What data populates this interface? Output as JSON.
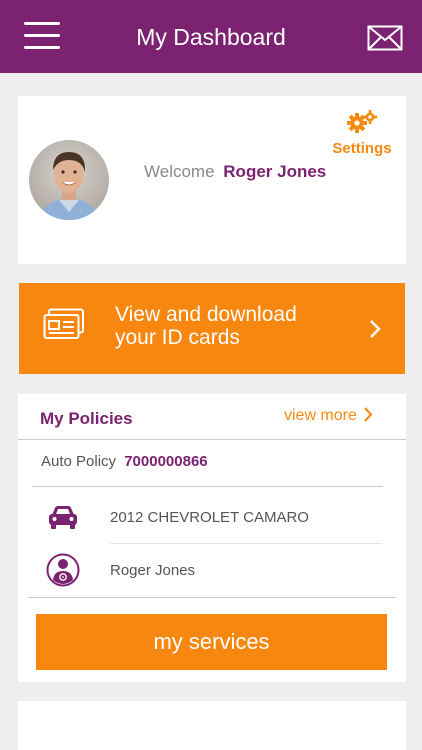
{
  "header": {
    "title": "My Dashboard",
    "menu_icon": "hamburger-menu-icon",
    "mail_icon": "envelope-icon",
    "background_color": "#7b2370"
  },
  "welcome": {
    "settings_label": "Settings",
    "welcome_text": "Welcome",
    "user_name": "Roger Jones"
  },
  "id_cards": {
    "label": "View and download\nyour ID cards",
    "icon": "id-card-icon",
    "accent_color": "#f7870f"
  },
  "policies": {
    "title": "My Policies",
    "view_more": "view more",
    "policy_label": "Auto Policy",
    "policy_number": "7000000866",
    "vehicle": "2012 CHEVROLET CAMARO",
    "driver": "Roger Jones",
    "services_button": "my services"
  }
}
